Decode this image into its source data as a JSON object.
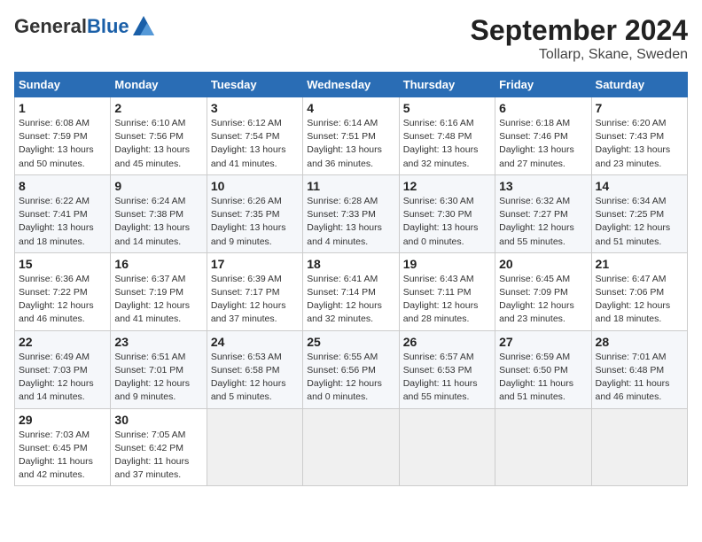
{
  "header": {
    "logo_general": "General",
    "logo_blue": "Blue",
    "title": "September 2024",
    "subtitle": "Tollarp, Skane, Sweden"
  },
  "columns": [
    "Sunday",
    "Monday",
    "Tuesday",
    "Wednesday",
    "Thursday",
    "Friday",
    "Saturday"
  ],
  "weeks": [
    [
      {
        "day": "1",
        "detail": "Sunrise: 6:08 AM\nSunset: 7:59 PM\nDaylight: 13 hours\nand 50 minutes."
      },
      {
        "day": "2",
        "detail": "Sunrise: 6:10 AM\nSunset: 7:56 PM\nDaylight: 13 hours\nand 45 minutes."
      },
      {
        "day": "3",
        "detail": "Sunrise: 6:12 AM\nSunset: 7:54 PM\nDaylight: 13 hours\nand 41 minutes."
      },
      {
        "day": "4",
        "detail": "Sunrise: 6:14 AM\nSunset: 7:51 PM\nDaylight: 13 hours\nand 36 minutes."
      },
      {
        "day": "5",
        "detail": "Sunrise: 6:16 AM\nSunset: 7:48 PM\nDaylight: 13 hours\nand 32 minutes."
      },
      {
        "day": "6",
        "detail": "Sunrise: 6:18 AM\nSunset: 7:46 PM\nDaylight: 13 hours\nand 27 minutes."
      },
      {
        "day": "7",
        "detail": "Sunrise: 6:20 AM\nSunset: 7:43 PM\nDaylight: 13 hours\nand 23 minutes."
      }
    ],
    [
      {
        "day": "8",
        "detail": "Sunrise: 6:22 AM\nSunset: 7:41 PM\nDaylight: 13 hours\nand 18 minutes."
      },
      {
        "day": "9",
        "detail": "Sunrise: 6:24 AM\nSunset: 7:38 PM\nDaylight: 13 hours\nand 14 minutes."
      },
      {
        "day": "10",
        "detail": "Sunrise: 6:26 AM\nSunset: 7:35 PM\nDaylight: 13 hours\nand 9 minutes."
      },
      {
        "day": "11",
        "detail": "Sunrise: 6:28 AM\nSunset: 7:33 PM\nDaylight: 13 hours\nand 4 minutes."
      },
      {
        "day": "12",
        "detail": "Sunrise: 6:30 AM\nSunset: 7:30 PM\nDaylight: 13 hours\nand 0 minutes."
      },
      {
        "day": "13",
        "detail": "Sunrise: 6:32 AM\nSunset: 7:27 PM\nDaylight: 12 hours\nand 55 minutes."
      },
      {
        "day": "14",
        "detail": "Sunrise: 6:34 AM\nSunset: 7:25 PM\nDaylight: 12 hours\nand 51 minutes."
      }
    ],
    [
      {
        "day": "15",
        "detail": "Sunrise: 6:36 AM\nSunset: 7:22 PM\nDaylight: 12 hours\nand 46 minutes."
      },
      {
        "day": "16",
        "detail": "Sunrise: 6:37 AM\nSunset: 7:19 PM\nDaylight: 12 hours\nand 41 minutes."
      },
      {
        "day": "17",
        "detail": "Sunrise: 6:39 AM\nSunset: 7:17 PM\nDaylight: 12 hours\nand 37 minutes."
      },
      {
        "day": "18",
        "detail": "Sunrise: 6:41 AM\nSunset: 7:14 PM\nDaylight: 12 hours\nand 32 minutes."
      },
      {
        "day": "19",
        "detail": "Sunrise: 6:43 AM\nSunset: 7:11 PM\nDaylight: 12 hours\nand 28 minutes."
      },
      {
        "day": "20",
        "detail": "Sunrise: 6:45 AM\nSunset: 7:09 PM\nDaylight: 12 hours\nand 23 minutes."
      },
      {
        "day": "21",
        "detail": "Sunrise: 6:47 AM\nSunset: 7:06 PM\nDaylight: 12 hours\nand 18 minutes."
      }
    ],
    [
      {
        "day": "22",
        "detail": "Sunrise: 6:49 AM\nSunset: 7:03 PM\nDaylight: 12 hours\nand 14 minutes."
      },
      {
        "day": "23",
        "detail": "Sunrise: 6:51 AM\nSunset: 7:01 PM\nDaylight: 12 hours\nand 9 minutes."
      },
      {
        "day": "24",
        "detail": "Sunrise: 6:53 AM\nSunset: 6:58 PM\nDaylight: 12 hours\nand 5 minutes."
      },
      {
        "day": "25",
        "detail": "Sunrise: 6:55 AM\nSunset: 6:56 PM\nDaylight: 12 hours\nand 0 minutes."
      },
      {
        "day": "26",
        "detail": "Sunrise: 6:57 AM\nSunset: 6:53 PM\nDaylight: 11 hours\nand 55 minutes."
      },
      {
        "day": "27",
        "detail": "Sunrise: 6:59 AM\nSunset: 6:50 PM\nDaylight: 11 hours\nand 51 minutes."
      },
      {
        "day": "28",
        "detail": "Sunrise: 7:01 AM\nSunset: 6:48 PM\nDaylight: 11 hours\nand 46 minutes."
      }
    ],
    [
      {
        "day": "29",
        "detail": "Sunrise: 7:03 AM\nSunset: 6:45 PM\nDaylight: 11 hours\nand 42 minutes."
      },
      {
        "day": "30",
        "detail": "Sunrise: 7:05 AM\nSunset: 6:42 PM\nDaylight: 11 hours\nand 37 minutes."
      },
      {
        "day": "",
        "detail": ""
      },
      {
        "day": "",
        "detail": ""
      },
      {
        "day": "",
        "detail": ""
      },
      {
        "day": "",
        "detail": ""
      },
      {
        "day": "",
        "detail": ""
      }
    ]
  ]
}
